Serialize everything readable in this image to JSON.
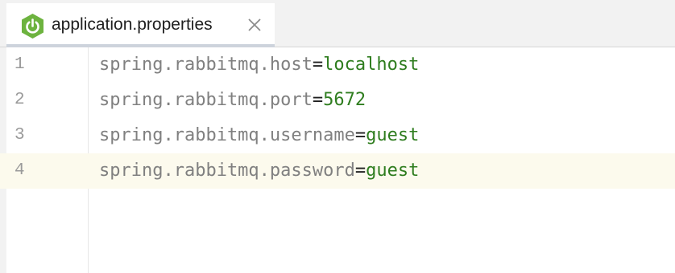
{
  "tab": {
    "filename": "application.properties",
    "icon": "spring-power-icon",
    "close_icon": "close-icon"
  },
  "editor": {
    "current_line": 4,
    "lines": [
      {
        "number": "1",
        "key": "spring.rabbitmq.host",
        "sep": "=",
        "value": "localhost"
      },
      {
        "number": "2",
        "key": "spring.rabbitmq.port",
        "sep": "=",
        "value": "5672"
      },
      {
        "number": "3",
        "key": "spring.rabbitmq.username",
        "sep": "=",
        "value": "guest"
      },
      {
        "number": "4",
        "key": "spring.rabbitmq.password",
        "sep": "=",
        "value": "guest"
      }
    ]
  },
  "colors": {
    "key": "#808080",
    "value": "#2f7d1f",
    "spring_green": "#6db33f",
    "current_line_bg": "#fcfaed"
  }
}
